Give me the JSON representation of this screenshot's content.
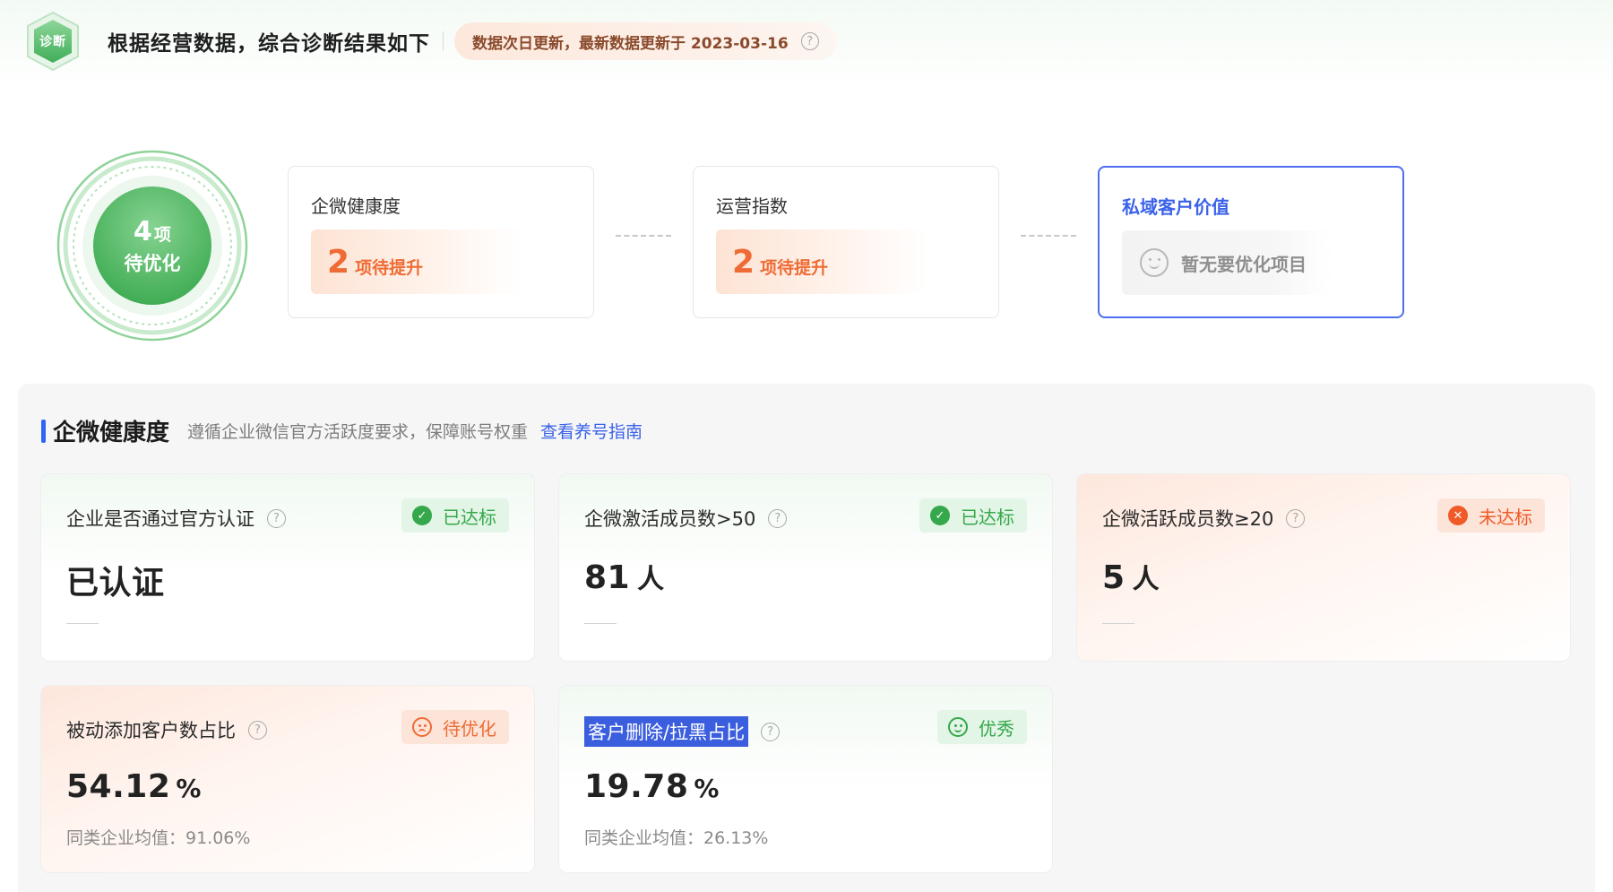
{
  "header": {
    "logo_text": "诊断",
    "title": "根据经营数据，综合诊断结果如下",
    "update_note": "数据次日更新，最新数据更新于 2023-03-16"
  },
  "overview": {
    "ring": {
      "count": "4",
      "unit": "项",
      "label": "待优化"
    },
    "cards": [
      {
        "title": "企微健康度",
        "count": "2",
        "text": "项待提升"
      },
      {
        "title": "运营指数",
        "count": "2",
        "text": "项待提升"
      },
      {
        "title": "私域客户价值",
        "empty_text": "暂无要优化项目"
      }
    ]
  },
  "health": {
    "title": "企微健康度",
    "description": "遵循企业微信官方活跃度要求，保障账号权重",
    "link": "查看养号指南",
    "cards": [
      {
        "title": "企业是否通过官方认证",
        "status": "已达标",
        "value": "已认证",
        "unit": ""
      },
      {
        "title": "企微激活成员数>50",
        "status": "已达标",
        "value": "81",
        "unit": "人"
      },
      {
        "title": "企微活跃成员数≥20",
        "status": "未达标",
        "value": "5",
        "unit": "人"
      },
      {
        "title": "被动添加客户数占比",
        "status": "待优化",
        "value": "54.12",
        "unit": "%",
        "avg": "同类企业均值：91.06%"
      },
      {
        "title": "客户删除/拉黑占比",
        "status": "优秀",
        "value": "19.78",
        "unit": "%",
        "avg": "同类企业均值：26.13%"
      }
    ]
  },
  "colors": {
    "brand_green": "#34a84a",
    "warning_orange": "#ef6b35",
    "accent_blue": "#3b62e8"
  }
}
